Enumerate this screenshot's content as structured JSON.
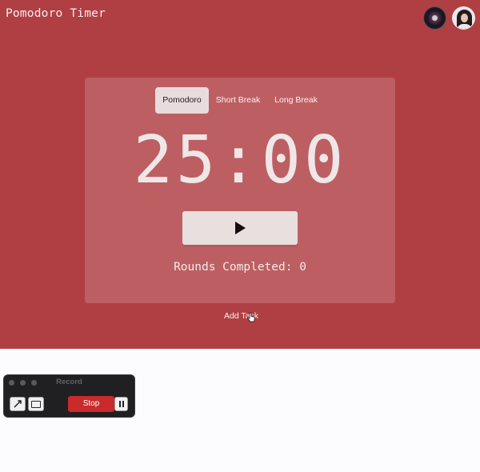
{
  "app": {
    "title": "Pomodoro Timer",
    "background": "#b03f43"
  },
  "header": {
    "avatars": [
      {
        "name": "avatar-galaxy"
      },
      {
        "name": "avatar-user"
      }
    ]
  },
  "timer_card": {
    "tabs": [
      {
        "label": "Pomodoro",
        "active": true
      },
      {
        "label": "Short Break",
        "active": false
      },
      {
        "label": "Long Break",
        "active": false
      }
    ],
    "time": "25:00",
    "play_icon": "play-icon",
    "rounds_label": "Rounds Completed: 0"
  },
  "add_task": {
    "label": "Add Task",
    "cursor_icon": "pointer-cursor-icon"
  },
  "recorder": {
    "title": "Record",
    "stop_label": "Stop",
    "tools": [
      "arrow-icon",
      "rectangle-icon"
    ],
    "pause_icon": "pause-icon",
    "stop_color": "#c92a2c"
  }
}
